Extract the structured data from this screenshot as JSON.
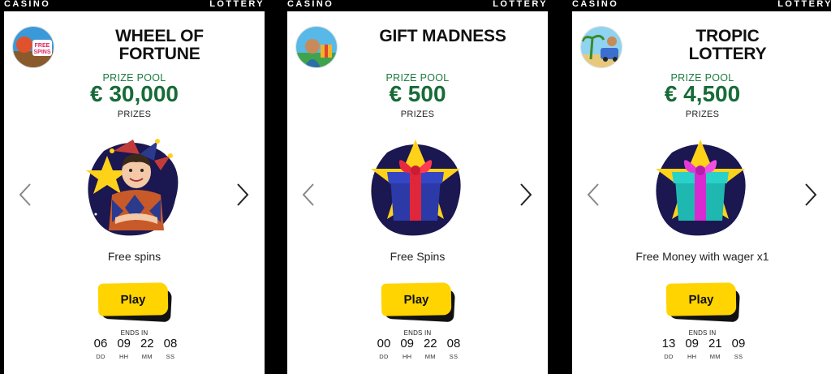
{
  "cards": [
    {
      "top_left": "CASINO",
      "top_right": "LOTTERY",
      "title_line1": "WHEEL OF",
      "title_line2": "FORTUNE",
      "thumb_text": "FREE SPINS",
      "pool_label": "PRIZE POOL",
      "pool_value": "€ 30,000",
      "prizes_label": "PRIZES",
      "prize_icon": "jester-character-illustration",
      "description": "Free spins",
      "play_label": "Play",
      "ends_label": "ENDS IN",
      "timer": {
        "dd": "06",
        "hh": "09",
        "mm": "22",
        "ss": "08"
      },
      "timer_labels": {
        "dd": "DD",
        "hh": "HH",
        "mm": "MM",
        "ss": "SS"
      }
    },
    {
      "top_left": "CASINO",
      "top_right": "LOTTERY",
      "title_line1": "GIFT MADNESS",
      "title_line2": "",
      "thumb_text": "",
      "pool_label": "PRIZE POOL",
      "pool_value": "€ 500",
      "prizes_label": "PRIZES",
      "prize_icon": "gift-box-blue-illustration",
      "description": "Free Spins",
      "play_label": "Play",
      "ends_label": "ENDS IN",
      "timer": {
        "dd": "00",
        "hh": "09",
        "mm": "22",
        "ss": "08"
      },
      "timer_labels": {
        "dd": "DD",
        "hh": "HH",
        "mm": "MM",
        "ss": "SS"
      }
    },
    {
      "top_left": "CASINO",
      "top_right": "LOTTERY",
      "title_line1": "TROPIC",
      "title_line2": "LOTTERY",
      "thumb_text": "",
      "pool_label": "PRIZE POOL",
      "pool_value": "€ 4,500",
      "prizes_label": "PRIZES",
      "prize_icon": "gift-box-teal-illustration",
      "description": "Free Money with wager x1",
      "play_label": "Play",
      "ends_label": "ENDS IN",
      "timer": {
        "dd": "13",
        "hh": "09",
        "mm": "21",
        "ss": "09"
      },
      "timer_labels": {
        "dd": "DD",
        "hh": "HH",
        "mm": "MM",
        "ss": "SS"
      }
    }
  ],
  "colors": {
    "accent_green": "#176b37",
    "play_yellow": "#ffd400",
    "star_yellow": "#ffd21a",
    "blob_navy": "#1b1750"
  }
}
